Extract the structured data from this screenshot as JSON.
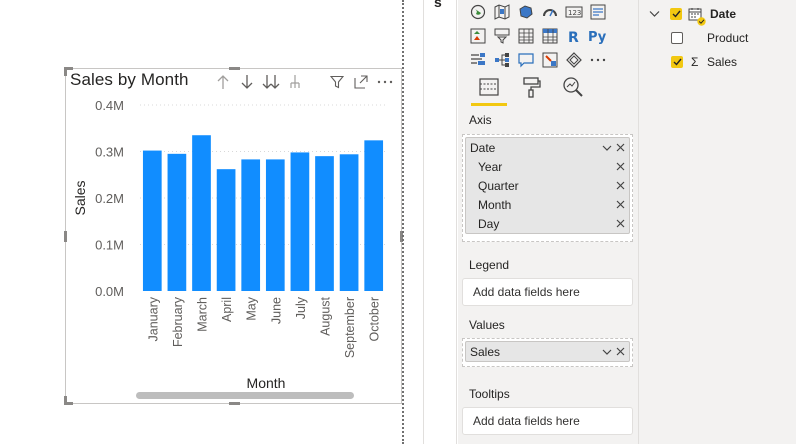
{
  "visual": {
    "title": "Sales by Month",
    "header_icons": [
      "arrow-up-icon",
      "arrow-down-icon",
      "double-arrow-down-icon",
      "expand-hierarchy-icon",
      "filter-icon",
      "focus-mode-icon",
      "more-options-icon"
    ]
  },
  "chart_data": {
    "type": "bar",
    "title": "Sales by Month",
    "xlabel": "Month",
    "ylabel": "Sales",
    "categories": [
      "January",
      "February",
      "March",
      "April",
      "May",
      "June",
      "July",
      "August",
      "September",
      "October"
    ],
    "values": [
      302000,
      295000,
      335000,
      262000,
      283000,
      283000,
      298000,
      290000,
      294000,
      324000
    ],
    "yticks": [
      "0.0M",
      "0.1M",
      "0.2M",
      "0.3M",
      "0.4M"
    ],
    "ylim": [
      0,
      400000
    ],
    "grid": true,
    "bar_color": "#118dff"
  },
  "viz_pane": {
    "strip_label": "s",
    "tabs": [
      "fields-tab",
      "format-tab",
      "analytics-tab"
    ],
    "sections": {
      "axis": {
        "label": "Axis",
        "field": "Date",
        "children": [
          "Year",
          "Quarter",
          "Month",
          "Day"
        ]
      },
      "legend": {
        "label": "Legend",
        "placeholder": "Add data fields here"
      },
      "values": {
        "label": "Values",
        "field": "Sales"
      },
      "tooltips": {
        "label": "Tooltips",
        "placeholder": "Add data fields here"
      }
    }
  },
  "fields_pane": {
    "table": "Date",
    "fields": [
      {
        "name": "Product",
        "checked": false,
        "sigma": false
      },
      {
        "name": "Sales",
        "checked": true,
        "sigma": true
      }
    ]
  },
  "colors": {
    "accent": "#f2c811",
    "bar": "#118dff"
  }
}
